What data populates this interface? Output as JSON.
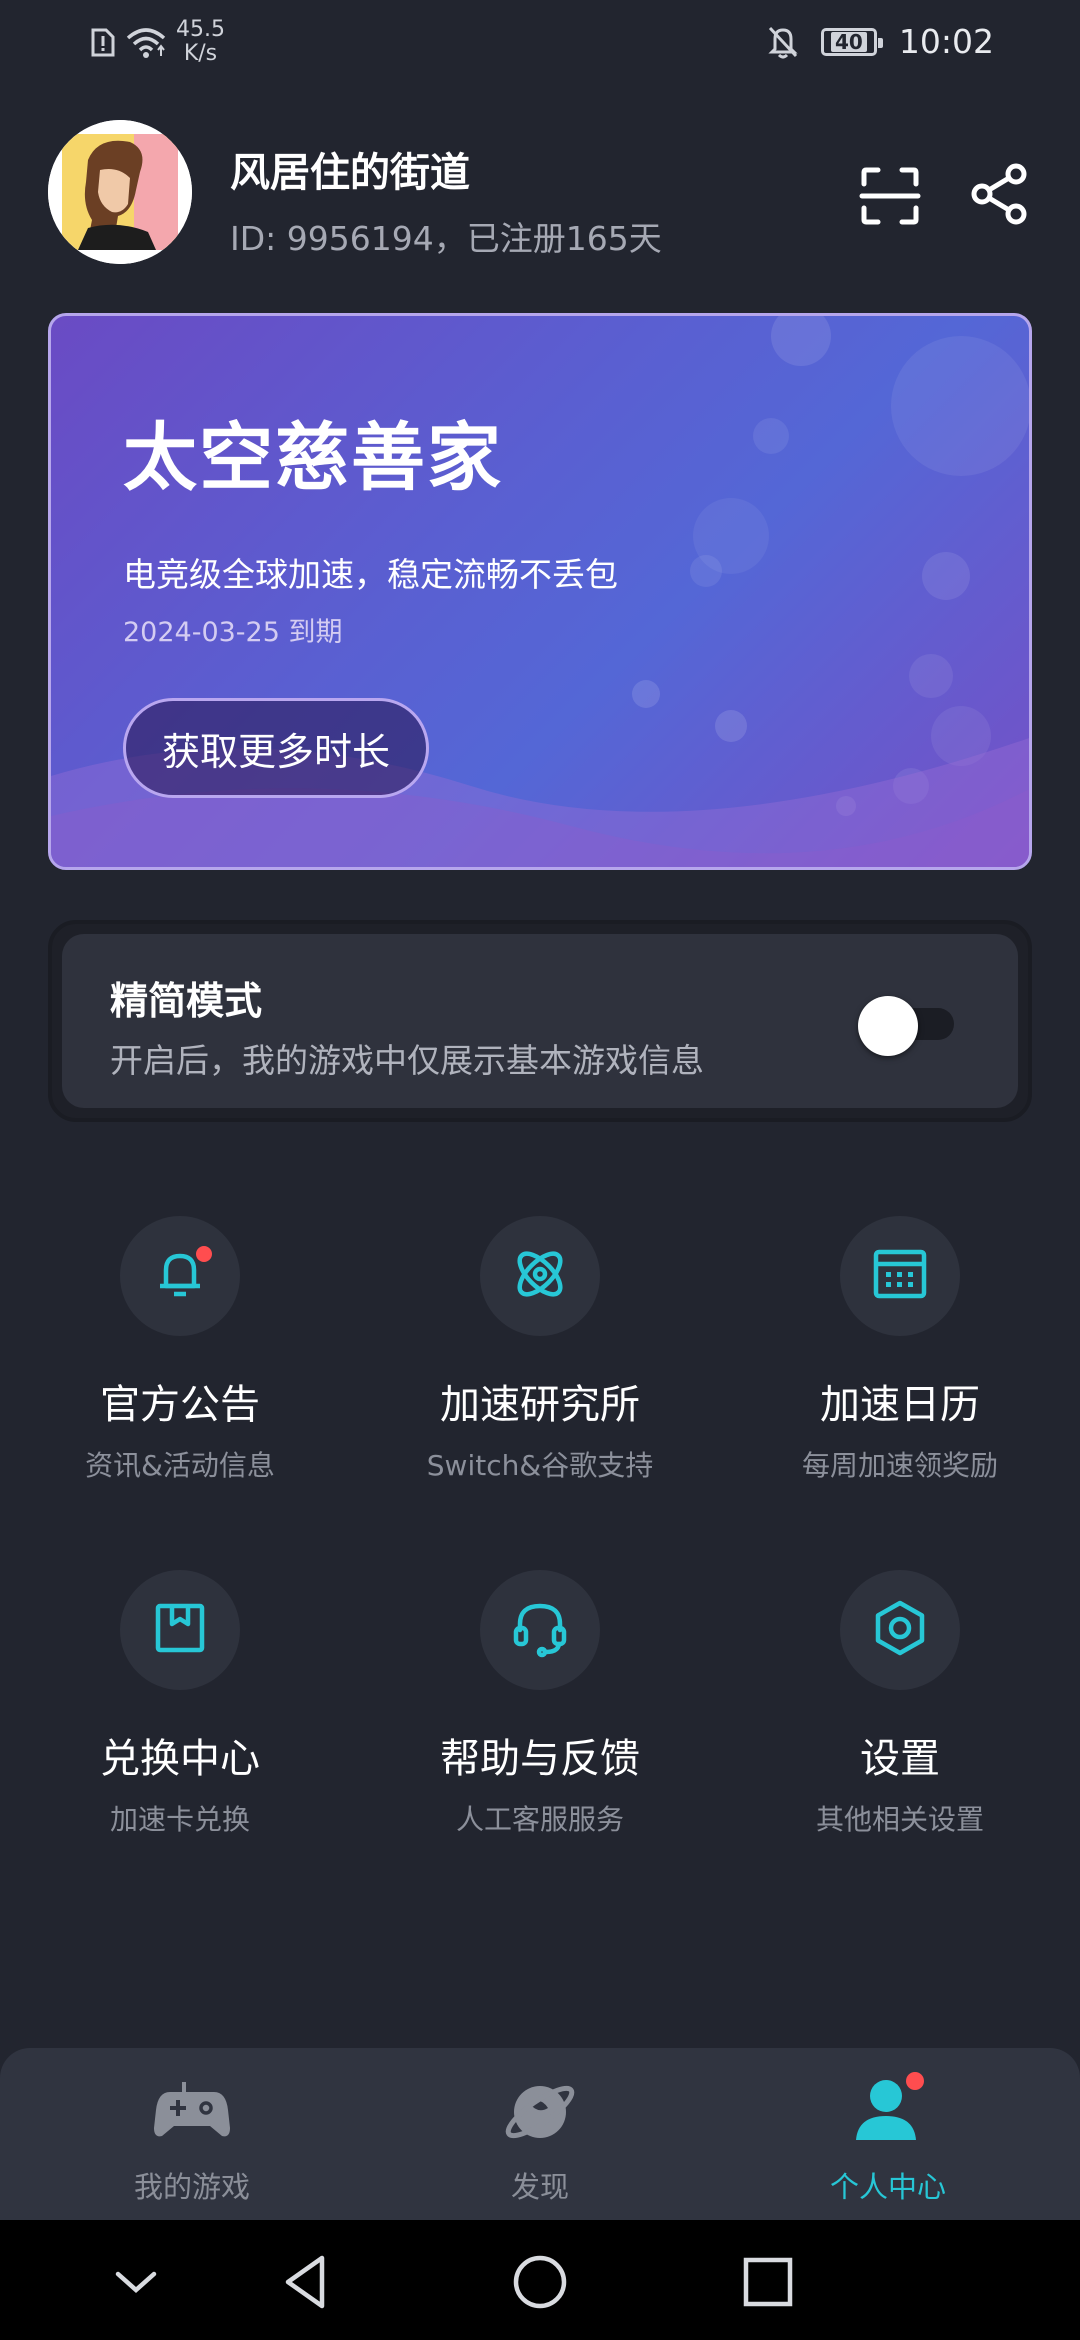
{
  "status_bar": {
    "net_speed_value": "45.5",
    "net_speed_unit": "K/s",
    "battery": "40",
    "time": "10:02",
    "icons": [
      "sim-alert-icon",
      "wifi-icon",
      "mute-bell-icon",
      "battery-icon"
    ]
  },
  "profile": {
    "name": "风居住的街道",
    "meta": "ID: 9956194，已注册165天",
    "scan_icon": "scan-icon",
    "share_icon": "share-icon"
  },
  "vip_card": {
    "title": "太空慈善家",
    "subtitle": "电竞级全球加速，稳定流畅不丢包",
    "expire": "2024-03-25 到期",
    "button_label": "获取更多时长"
  },
  "simple_mode": {
    "title": "精简模式",
    "description": "开启后，我的游戏中仅展示基本游戏信息",
    "enabled": false
  },
  "features": [
    {
      "title": "官方公告",
      "subtitle": "资讯&活动信息",
      "icon": "bell-icon",
      "badge": true
    },
    {
      "title": "加速研究所",
      "subtitle": "Switch&谷歌支持",
      "icon": "atom-icon",
      "badge": false
    },
    {
      "title": "加速日历",
      "subtitle": "每周加速领奖励",
      "icon": "calendar-icon",
      "badge": false
    },
    {
      "title": "兑换中心",
      "subtitle": "加速卡兑换",
      "icon": "gift-box-icon",
      "badge": false
    },
    {
      "title": "帮助与反馈",
      "subtitle": "人工客服服务",
      "icon": "headset-icon",
      "badge": false
    },
    {
      "title": "设置",
      "subtitle": "其他相关设置",
      "icon": "settings-icon",
      "badge": false
    }
  ],
  "tabs": [
    {
      "label": "我的游戏",
      "icon": "gamepad-icon",
      "active": false
    },
    {
      "label": "发现",
      "icon": "planet-icon",
      "active": false
    },
    {
      "label": "个人中心",
      "icon": "person-icon",
      "active": true,
      "badge": true
    }
  ],
  "colors": {
    "background": "#22252f",
    "accent": "#27c7d6",
    "badge": "#ff4d4f",
    "card_purple": "#5a5fd1"
  },
  "nav": [
    "back-chevron-icon",
    "back-triangle-icon",
    "home-circle-icon",
    "recents-square-icon"
  ]
}
